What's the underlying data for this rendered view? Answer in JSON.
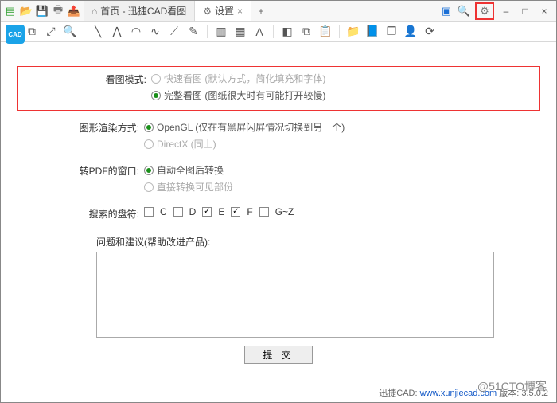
{
  "titlebar": {
    "tabs": [
      {
        "icon": "⌂",
        "label": "首页 - 迅捷CAD看图"
      },
      {
        "icon": "⚙",
        "label": "设置"
      }
    ],
    "add_label": "+"
  },
  "window_controls": {
    "min": "–",
    "max": "□",
    "close": "×"
  },
  "app_icon_text": "CAD",
  "settings": {
    "view_mode": {
      "label": "看图模式:",
      "opt_fast": "快速看图 (默认方式，简化填充和字体)",
      "opt_full": "完整看图 (图纸很大时有可能打开较慢)"
    },
    "render": {
      "label": "图形渲染方式:",
      "opt_opengl": "OpenGL (仅在有黑屏闪屏情况切换到另一个)",
      "opt_directx": "DirectX  (同上)"
    },
    "pdf": {
      "label": "转PDF的窗口:",
      "opt_auto": "自动全图后转换",
      "opt_direct": "直接转换可见部份"
    },
    "drives": {
      "label": "搜索的盘符:",
      "items": [
        {
          "label": "C",
          "checked": false
        },
        {
          "label": "D",
          "checked": false
        },
        {
          "label": "E",
          "checked": true
        },
        {
          "label": "F",
          "checked": true
        },
        {
          "label": "G~Z",
          "checked": false
        }
      ]
    },
    "feedback_label": "问题和建议(帮助改进产品):",
    "submit": "提 交"
  },
  "footer": {
    "prefix": "迅捷CAD: ",
    "link_text": "www.xunjiecad.com",
    "suffix": " 版本: 3.5.0.2"
  },
  "watermark": "@51CTO博客"
}
